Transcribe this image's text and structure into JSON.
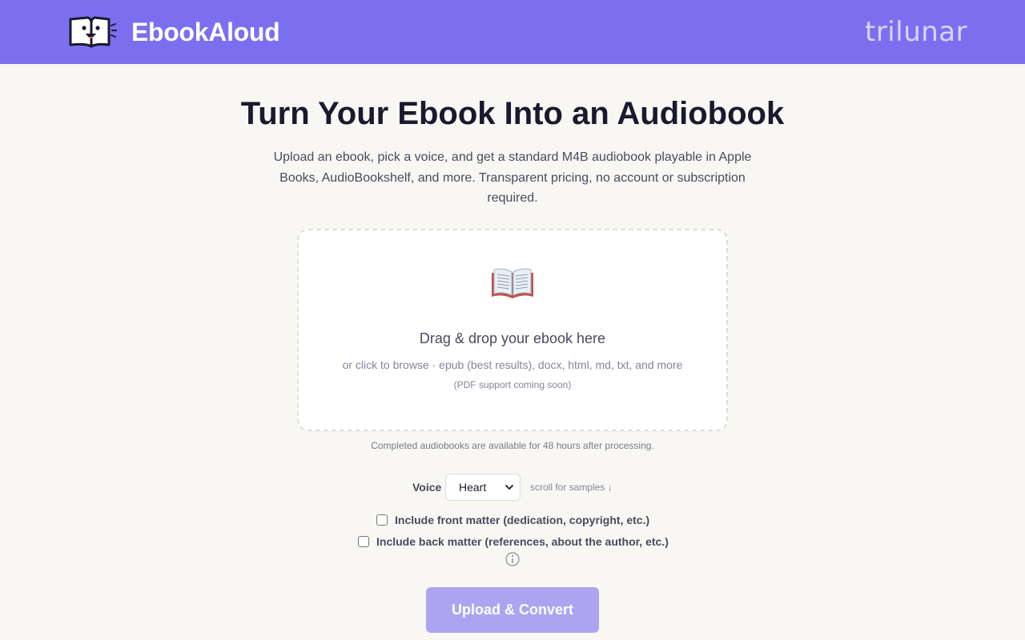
{
  "header": {
    "app_title": "EbookAloud",
    "brand": "trilunar",
    "logo_icon": "book-mascot-icon"
  },
  "hero": {
    "title": "Turn Your Ebook Into an Audiobook",
    "subtitle": "Upload an ebook, pick a voice, and get a standard M4B audiobook playable in Apple Books, AudioBookshelf, and more. Transparent pricing, no account or subscription required."
  },
  "dropzone": {
    "icon": "open-book-icon",
    "title": "Drag & drop your ebook here",
    "hint": "or click to browse · epub (best results), docx, html, md, txt, and more",
    "note": "(PDF support coming soon)"
  },
  "retention_note": "Completed audiobooks are available for 48 hours after processing.",
  "voice": {
    "label": "Voice",
    "selected": "Heart",
    "hint": "scroll for samples ↓"
  },
  "options": {
    "front_matter": {
      "label": "Include front matter (dedication, copyright, etc.)",
      "checked": false
    },
    "back_matter": {
      "label": "Include back matter (references, about the author, etc.)",
      "checked": false
    }
  },
  "submit_label": "Upload & Convert",
  "colors": {
    "header_bg": "#7b6ff0",
    "button_bg": "#ada4f1",
    "page_bg": "#f8f7f3",
    "text_dark": "#1a1a2e"
  }
}
